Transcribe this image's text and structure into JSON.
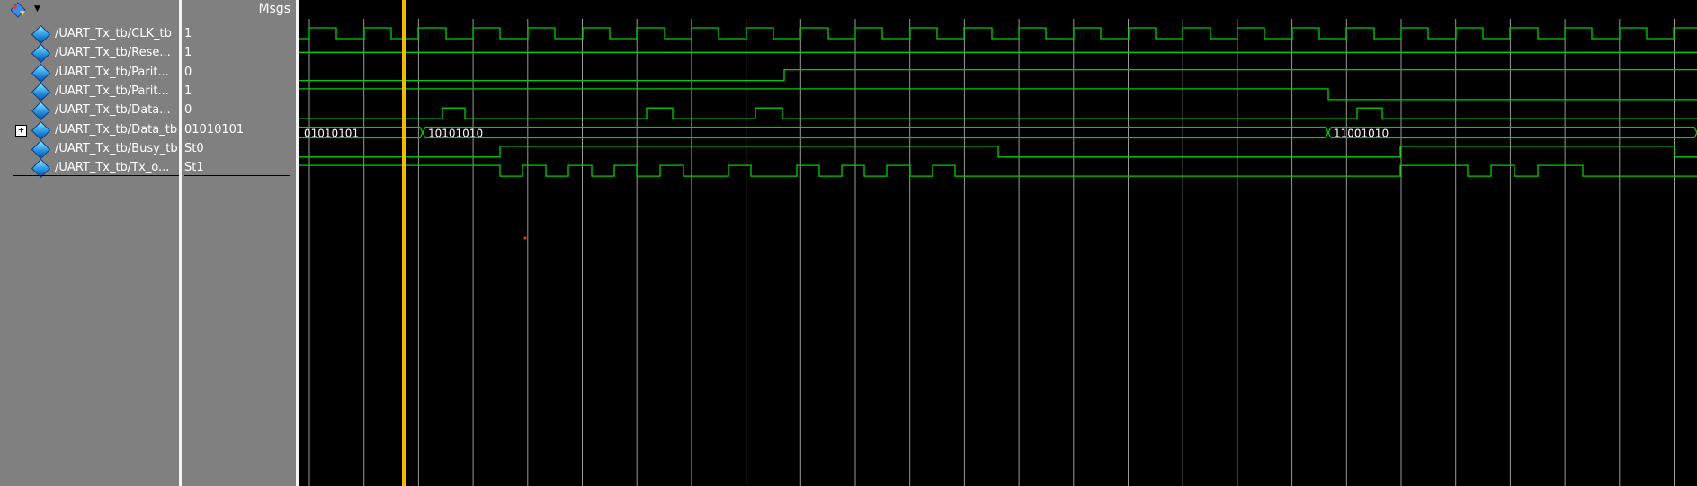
{
  "header": {
    "msgs_label": "Msgs",
    "toolbar_icon": "wave-tool-icon"
  },
  "signals": [
    {
      "name": "/UART_Tx_tb/CLK_tb",
      "value": "1"
    },
    {
      "name": "/UART_Tx_tb/Rese...",
      "value": "1"
    },
    {
      "name": "/UART_Tx_tb/Parit...",
      "value": "0"
    },
    {
      "name": "/UART_Tx_tb/Parit...",
      "value": "1"
    },
    {
      "name": "/UART_Tx_tb/Data...",
      "value": "0"
    },
    {
      "name": "/UART_Tx_tb/Data_tb",
      "value": "01010101",
      "expandable": true
    },
    {
      "name": "/UART_Tx_tb/Busy_tb",
      "value": "St0"
    },
    {
      "name": "/UART_Tx_tb/Tx_o...",
      "value": "St1"
    }
  ],
  "bus_labels": [
    "01010101",
    "10101010",
    "11001010"
  ],
  "colors": {
    "wave": "#00d000",
    "cursor": "#f2b90b",
    "grid": "#9a9a9a",
    "panel": "#808080"
  }
}
